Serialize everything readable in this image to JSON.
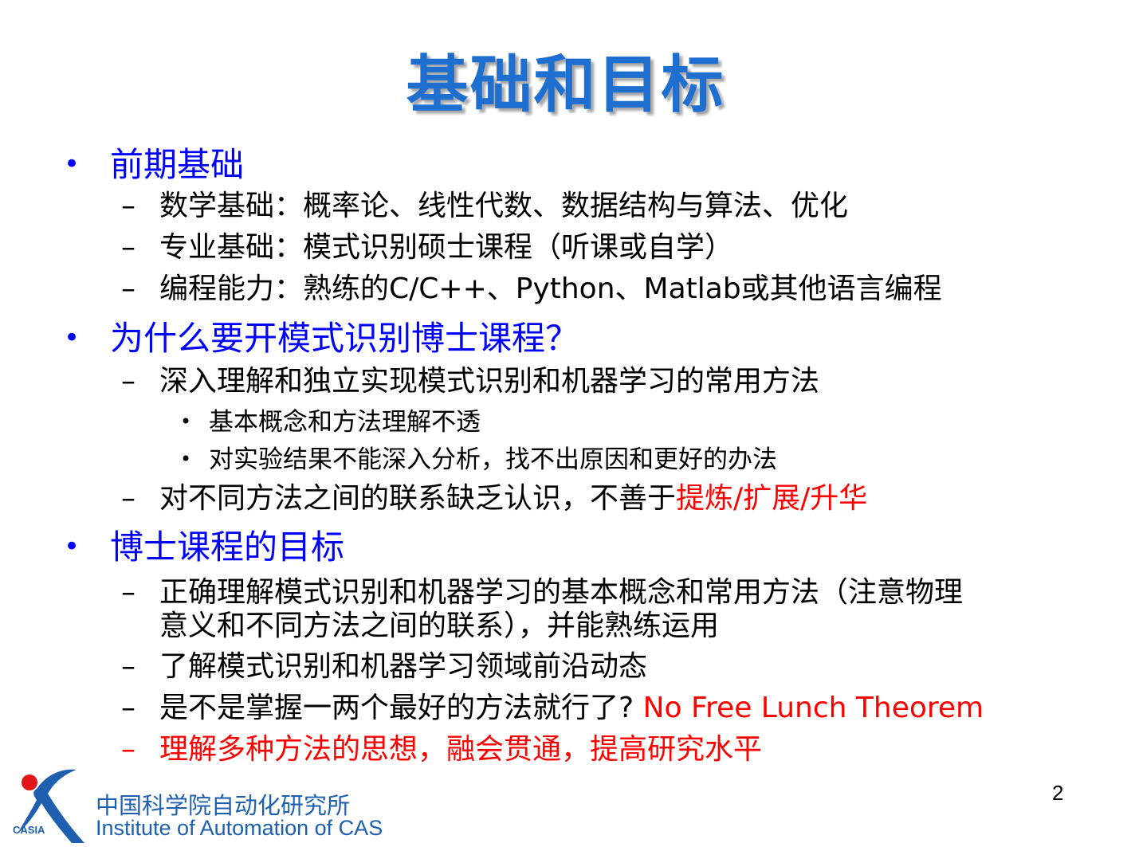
{
  "title": "基础和目标",
  "sections": [
    {
      "heading": "前期基础",
      "items": [
        "数学基础：概率论、线性代数、数据结构与算法、优化",
        "专业基础：模式识别硕士课程（听课或自学）",
        "编程能力：熟练的C/C++、Python、Matlab或其他语言编程"
      ]
    },
    {
      "heading": "为什么要开模式识别博士课程？",
      "item1": "深入理解和独立实现模式识别和机器学习的常用方法",
      "sub_items": [
        "基本概念和方法理解不透",
        "对实验结果不能深入分析，找不出原因和更好的办法"
      ],
      "item2_prefix": "对不同方法之间的联系缺乏认识，不善于",
      "item2_highlight": "提炼/扩展/升华"
    },
    {
      "heading": "博士课程的目标",
      "item1_line1": "正确理解模式识别和机器学习的基本概念和常用方法（注意物理",
      "item1_line2": "意义和不同方法之间的联系），并能熟练运用",
      "item2": "了解模式识别和机器学习领域前沿动态",
      "item3_prefix": "是不是掌握一两个最好的方法就行了? ",
      "item3_highlight": "No Free Lunch Theorem",
      "item4": "理解多种方法的思想，融会贯通，提高研究水平"
    }
  ],
  "symbols": {
    "bullet": "•",
    "dash": "–"
  },
  "footer": {
    "page_number": "2",
    "org_cn": "中国科学院自动化研究所",
    "org_en": "Institute of Automation of CAS",
    "logo_text": "CASIA"
  },
  "colors": {
    "title": "#1e6fd0",
    "heading": "#0000ff",
    "highlight": "#ff0000",
    "footer": "#1f5fb0"
  }
}
